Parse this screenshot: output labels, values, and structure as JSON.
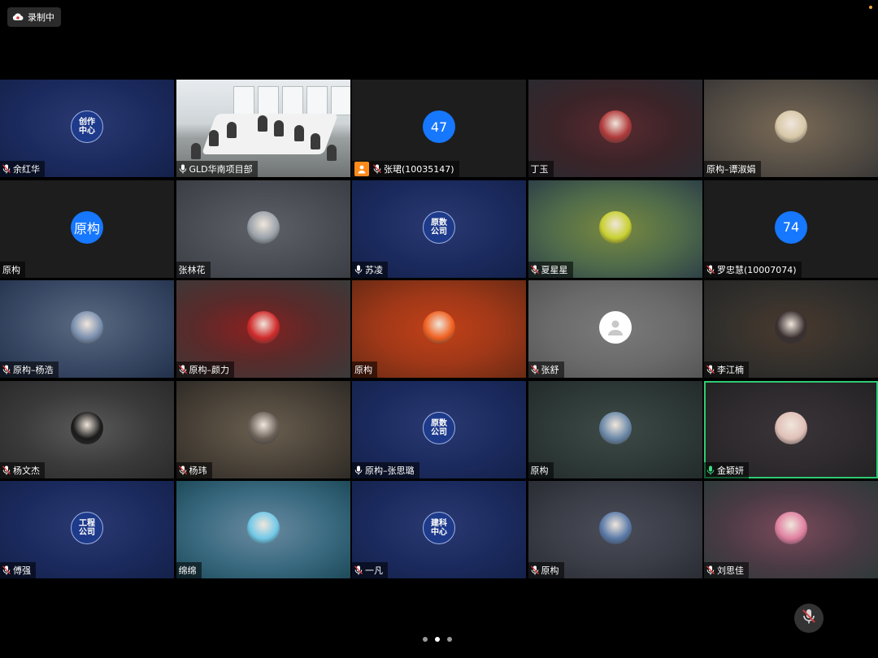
{
  "recording": {
    "label": "录制中"
  },
  "pager": {
    "pages": 3,
    "current": 1
  },
  "colors": {
    "active_border": "#2ecc71",
    "avatar_blue": "#1677ff",
    "guest_badge": "#ff8a1c"
  },
  "tiles": [
    {
      "name": "余红华",
      "mic": "muted",
      "avatar": "org",
      "org_text": "创作\n中心",
      "bg": "bg-navy"
    },
    {
      "name": "GLD华南项目部",
      "mic": "on",
      "avatar": "video",
      "bg": "room"
    },
    {
      "name": "张珺(10035147)",
      "mic": "muted",
      "avatar": "num",
      "avatar_text": "47",
      "bg": "bg-dark",
      "guest": true
    },
    {
      "name": "丁玉",
      "mic": "none",
      "avatar": "pic",
      "pic_color": "#b03a3a",
      "bg": "bg-darkred"
    },
    {
      "name": "原构–谭淑娟",
      "mic": "none",
      "avatar": "pic",
      "pic_color": "#d8c8a8",
      "bg": "bg-beige"
    },
    {
      "name": "原构",
      "mic": "none",
      "avatar": "txt",
      "avatar_text": "原构",
      "bg": "bg-dark"
    },
    {
      "name": "张林花",
      "mic": "none",
      "avatar": "pic",
      "pic_color": "#9aa2aa",
      "bg": "bg-gray"
    },
    {
      "name": "苏凌",
      "mic": "on",
      "avatar": "org",
      "org_text": "原数\n公司",
      "bg": "bg-navy"
    },
    {
      "name": "夏星星",
      "mic": "muted",
      "avatar": "pic",
      "pic_color": "#c8d030",
      "bg": "bg-olive"
    },
    {
      "name": "罗忠慧(10007074)",
      "mic": "muted",
      "avatar": "num",
      "avatar_text": "74",
      "bg": "bg-dark"
    },
    {
      "name": "原构–杨浩",
      "mic": "muted",
      "avatar": "pic",
      "pic_color": "#7a90b0",
      "bg": "bg-blueish"
    },
    {
      "name": "原构–颜力",
      "mic": "muted",
      "avatar": "pic",
      "pic_color": "#d02a2a",
      "bg": "bg-red"
    },
    {
      "name": "原构",
      "mic": "none",
      "avatar": "pic",
      "pic_color": "#f06020",
      "bg": "bg-orange"
    },
    {
      "name": "张舒",
      "mic": "muted",
      "avatar": "default",
      "bg": "bg-lightgray"
    },
    {
      "name": "李江楠",
      "mic": "muted",
      "avatar": "pic",
      "pic_color": "#3a3030",
      "bg": "bg-brown"
    },
    {
      "name": "杨文杰",
      "mic": "muted",
      "avatar": "pic",
      "pic_color": "#1a1a1a",
      "bg": "bg-charcoal"
    },
    {
      "name": "杨玮",
      "mic": "muted",
      "avatar": "pic",
      "pic_color": "#6a6058",
      "bg": "bg-warm"
    },
    {
      "name": "原构–张思璐",
      "mic": "on",
      "avatar": "org",
      "org_text": "原数\n公司",
      "bg": "bg-navy"
    },
    {
      "name": "原构",
      "mic": "none",
      "avatar": "pic",
      "pic_color": "#6a88a8",
      "bg": "bg-muted"
    },
    {
      "name": "金颖妍",
      "mic": "active",
      "avatar": "pic",
      "pic_color": "#e0c0b8",
      "bg": "bg-darkplain",
      "active": true
    },
    {
      "name": "傅强",
      "mic": "muted",
      "avatar": "org",
      "org_text": "工程\n公司",
      "bg": "bg-navy"
    },
    {
      "name": "绵绵",
      "mic": "none",
      "avatar": "pic",
      "pic_color": "#70c8e8",
      "bg": "bg-teal"
    },
    {
      "name": "一凡",
      "mic": "muted",
      "avatar": "org",
      "org_text": "建科\n中心",
      "bg": "bg-navy"
    },
    {
      "name": "原构",
      "mic": "muted",
      "avatar": "pic",
      "pic_color": "#5a7aa8",
      "bg": "bg-slate"
    },
    {
      "name": "刘思佳",
      "mic": "muted",
      "avatar": "pic",
      "pic_color": "#e080a0",
      "bg": "bg-pinkish"
    }
  ]
}
